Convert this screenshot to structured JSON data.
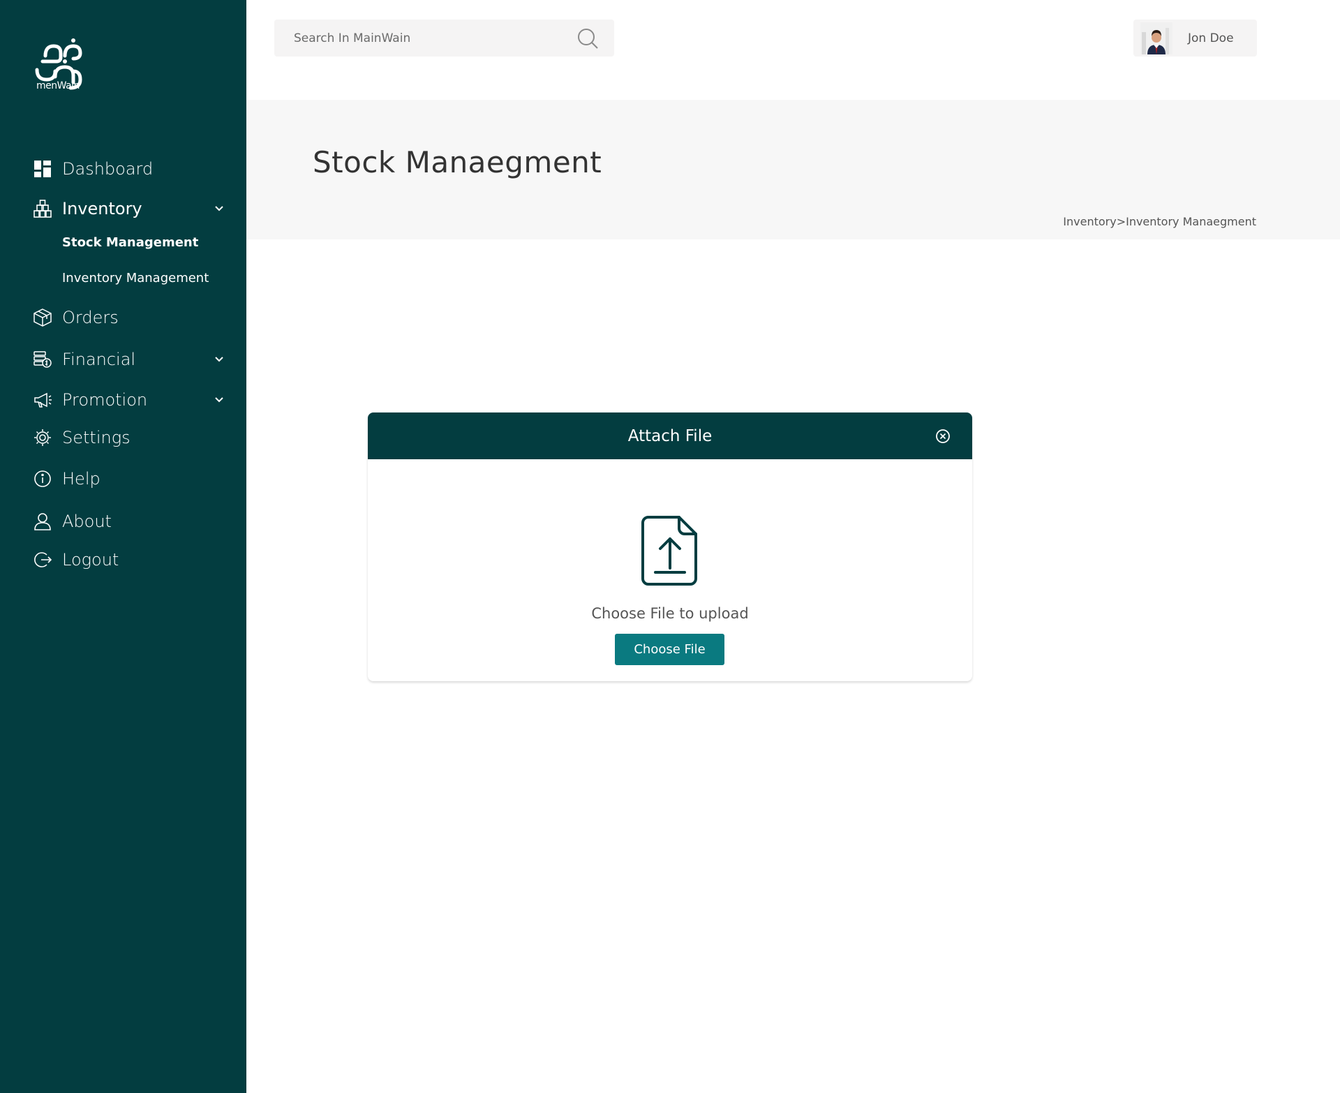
{
  "brand": {
    "logo_text": "menWain"
  },
  "sidebar": {
    "items": [
      {
        "label": "Dashboard",
        "icon": "dashboard-icon"
      },
      {
        "label": "Inventory",
        "icon": "inventory-icon",
        "expanded": true
      },
      {
        "label": "Orders",
        "icon": "orders-icon"
      },
      {
        "label": "Financial",
        "icon": "financial-icon"
      },
      {
        "label": "Promotion",
        "icon": "promotion-icon"
      },
      {
        "label": "Settings",
        "icon": "settings-icon"
      },
      {
        "label": "Help",
        "icon": "help-icon"
      },
      {
        "label": "About",
        "icon": "about-icon"
      },
      {
        "label": "Logout",
        "icon": "logout-icon"
      }
    ],
    "inventory_sub": [
      {
        "label": "Stock Management",
        "active": true
      },
      {
        "label": "Inventory Management",
        "active": false
      }
    ]
  },
  "header": {
    "search_placeholder": "Search In MainWain",
    "user_name": "Jon Doe"
  },
  "page": {
    "title": "Stock Manaegment",
    "breadcrumb": "Inventory>Inventory Manaegment"
  },
  "modal": {
    "title": "Attach File",
    "prompt": "Choose File to upload",
    "button_label": "Choose File"
  },
  "colors": {
    "sidebar_bg": "#033d40",
    "accent": "#0a7a80",
    "heading_band": "#f7f7f7"
  }
}
